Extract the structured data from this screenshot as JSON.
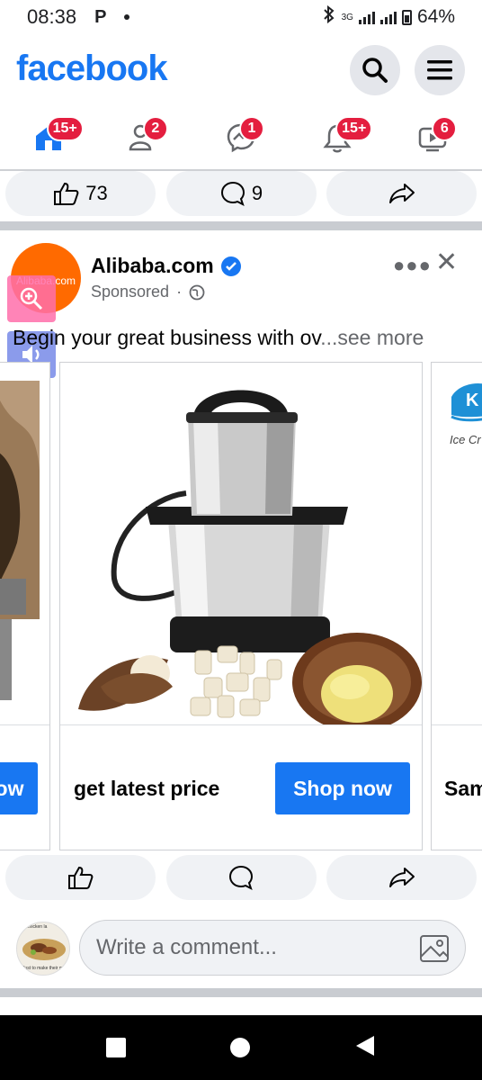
{
  "status_bar": {
    "time": "08:38",
    "app_badge": "P",
    "network": "3G",
    "battery": "64%"
  },
  "header": {
    "logo": "facebook"
  },
  "nav": {
    "items": [
      {
        "name": "home",
        "badge": "15+"
      },
      {
        "name": "friends",
        "badge": "2"
      },
      {
        "name": "messenger",
        "badge": "1"
      },
      {
        "name": "notifications",
        "badge": "15+"
      },
      {
        "name": "watch",
        "badge": "6"
      }
    ]
  },
  "prev_post": {
    "likes": "73",
    "comments": "9"
  },
  "post": {
    "avatar_text": "Alibaba.com",
    "page_name": "Alibaba.com",
    "sponsored": "Sponsored",
    "separator": "·",
    "text": "Begin your great business with ov",
    "see_more": "...see more",
    "cards": [
      {
        "title": "",
        "cta": "ow"
      },
      {
        "title": "get latest price",
        "cta": "Shop now"
      },
      {
        "title": "Sam",
        "cta": "",
        "brand_text": "Ice Cr"
      }
    ]
  },
  "comment": {
    "placeholder": "Write a comment...",
    "avatar_caption_top": "• chicken la",
    "avatar_caption_bottom": "Just to make their mouth w"
  },
  "colors": {
    "brand": "#1877f2",
    "badge": "#e41e3f",
    "muted": "#65676b",
    "surface": "#f0f2f5"
  }
}
